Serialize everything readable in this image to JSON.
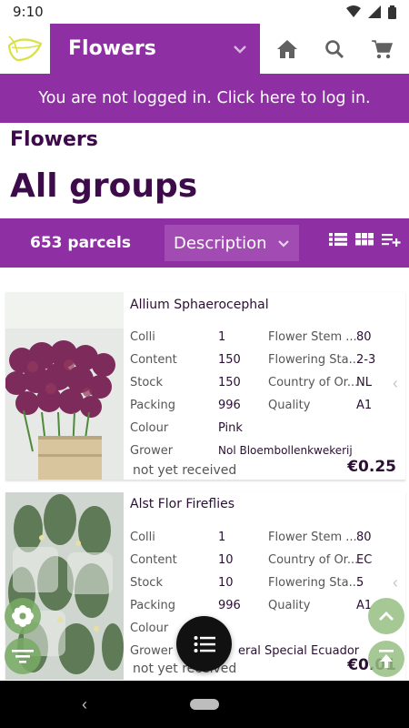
{
  "status_bar": {
    "time": "9:10"
  },
  "header": {
    "title": "Flowers"
  },
  "login_banner": "You are not logged in. Click here to log in.",
  "breadcrumb": "Flowers",
  "page_title": "All groups",
  "toolbar": {
    "parcel_count": "653 parcels",
    "sort_value": "Description"
  },
  "products": [
    {
      "name": "Allium Sphaerocephal",
      "specs_left": [
        {
          "label": "Colli",
          "value": "1"
        },
        {
          "label": "Content",
          "value": "150"
        },
        {
          "label": "Stock",
          "value": "150"
        },
        {
          "label": "Packing",
          "value": "996"
        },
        {
          "label": "Colour",
          "value": "Pink"
        },
        {
          "label": "Grower",
          "value": "Nol Bloembollenkwekerij"
        }
      ],
      "specs_right": [
        {
          "label": "Flower Stem ...",
          "value": "80"
        },
        {
          "label": "Flowering Sta...",
          "value": "2-3"
        },
        {
          "label": "Country of Or...",
          "value": "NL"
        },
        {
          "label": "Quality",
          "value": "A1"
        }
      ],
      "status": "not yet received",
      "price": "€0.25"
    },
    {
      "name": "Alst Flor Fireflies",
      "specs_left": [
        {
          "label": "Colli",
          "value": "1"
        },
        {
          "label": "Content",
          "value": "10"
        },
        {
          "label": "Stock",
          "value": "10"
        },
        {
          "label": "Packing",
          "value": "996"
        },
        {
          "label": "Colour",
          "value": ""
        },
        {
          "label": "Grower",
          "value": "eral Special Ecuador"
        }
      ],
      "specs_right": [
        {
          "label": "Flower Stem ...",
          "value": "80"
        },
        {
          "label": "Country of Or...",
          "value": "EC"
        },
        {
          "label": "Flowering Sta...",
          "value": "5"
        },
        {
          "label": "Quality",
          "value": "A1"
        }
      ],
      "status": "not yet received",
      "price": "€0.01"
    }
  ],
  "colors": {
    "brand_purple": "#8e2fa3",
    "title_dark": "#3d0b4a",
    "accent_green": "#8bb676"
  },
  "icons": [
    "logo-leaf-icon",
    "chevron-down-icon",
    "home-icon",
    "search-icon",
    "cart-icon",
    "list-view-icon",
    "grid-view-icon",
    "playlist-add-icon",
    "flower-filter-icon",
    "filter-icon",
    "menu-list-icon",
    "chevron-up-icon",
    "scroll-top-icon",
    "chevron-right-icon"
  ]
}
